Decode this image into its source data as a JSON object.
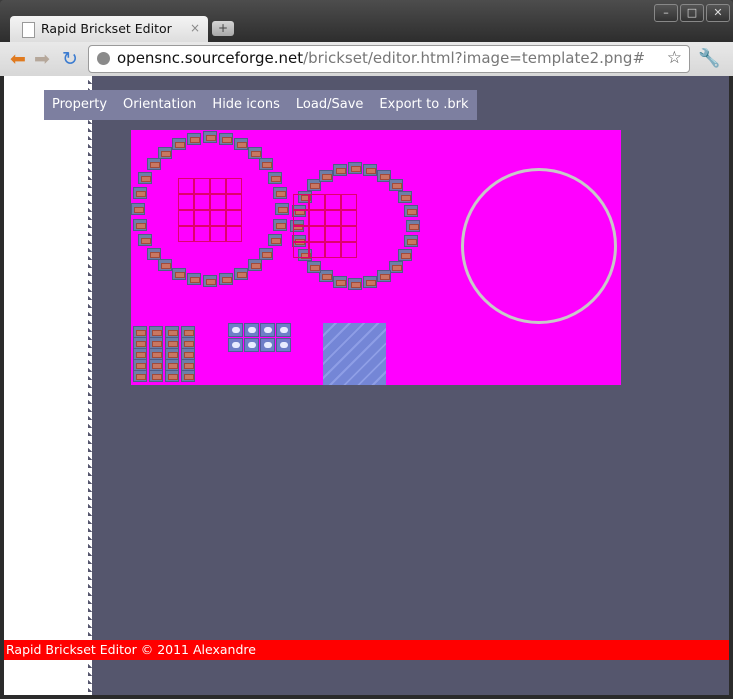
{
  "browser": {
    "tab_title": "Rapid Brickset Editor",
    "tab_close": "×",
    "new_tab": "+",
    "url_host": "opensnc.sourceforge.net",
    "url_path": "/brickset/editor.html?image=template2.png#",
    "win_minimize": "–",
    "win_maximize": "□",
    "win_close": "✕"
  },
  "menu": {
    "items": [
      "Property",
      "Orientation",
      "Hide icons",
      "Load/Save",
      "Export to .brk"
    ]
  },
  "canvas": {
    "background": "#ff00ff",
    "image": "template2.png"
  },
  "footer": {
    "text": "Rapid Brickset Editor © 2011 Alexandre"
  },
  "colors": {
    "workspace": "#55566d",
    "menu_bg": "#7d7fa0",
    "footer_bg": "#ff0000"
  }
}
